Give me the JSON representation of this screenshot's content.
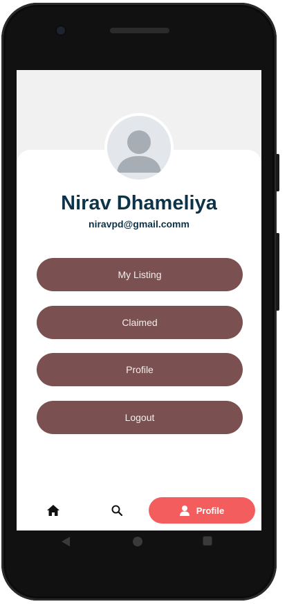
{
  "profile": {
    "name": "Nirav Dhameliya",
    "email": "niravpd@gmail.comm",
    "avatar_icon": "user-placeholder-icon"
  },
  "menu": [
    {
      "label": "My Listing"
    },
    {
      "label": "Claimed"
    },
    {
      "label": "Profile"
    },
    {
      "label": "Logout"
    }
  ],
  "tabbar": {
    "home_icon": "home-icon",
    "search_icon": "search-icon",
    "profile_label": "Profile",
    "active": "Profile"
  },
  "colors": {
    "menu_button": "#7a5050",
    "active_tab": "#f45d5d",
    "name_text": "#0d3349"
  }
}
